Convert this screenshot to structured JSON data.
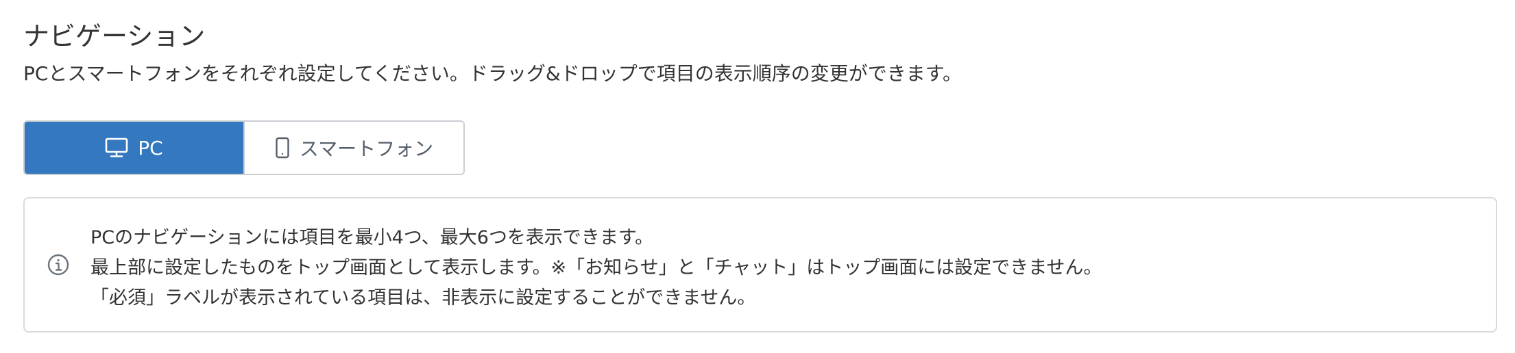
{
  "navigation": {
    "title": "ナビゲーション",
    "description": "PCとスマートフォンをそれぞれ設定してください。ドラッグ&ドロップで項目の表示順序の変更ができます。"
  },
  "device_toggle": {
    "pc_label": "PC",
    "smartphone_label": "スマートフォン",
    "selected": "PC",
    "pc_icon": "monitor-icon",
    "smartphone_icon": "smartphone-icon"
  },
  "notice": {
    "icon": "info-icon",
    "lines": [
      "PCのナビゲーションには項目を最小4つ、最大6つを表示できます。",
      "最上部に設定したものをトップ画面として表示します。※「お知らせ」と「チャット」はトップ画面には設定できません。",
      "「必須」ラベルが表示されている項目は、非表示に設定することができません。"
    ]
  },
  "colors": {
    "accent": "#3478c0",
    "text": "#333333",
    "border": "#c9cdd2"
  }
}
